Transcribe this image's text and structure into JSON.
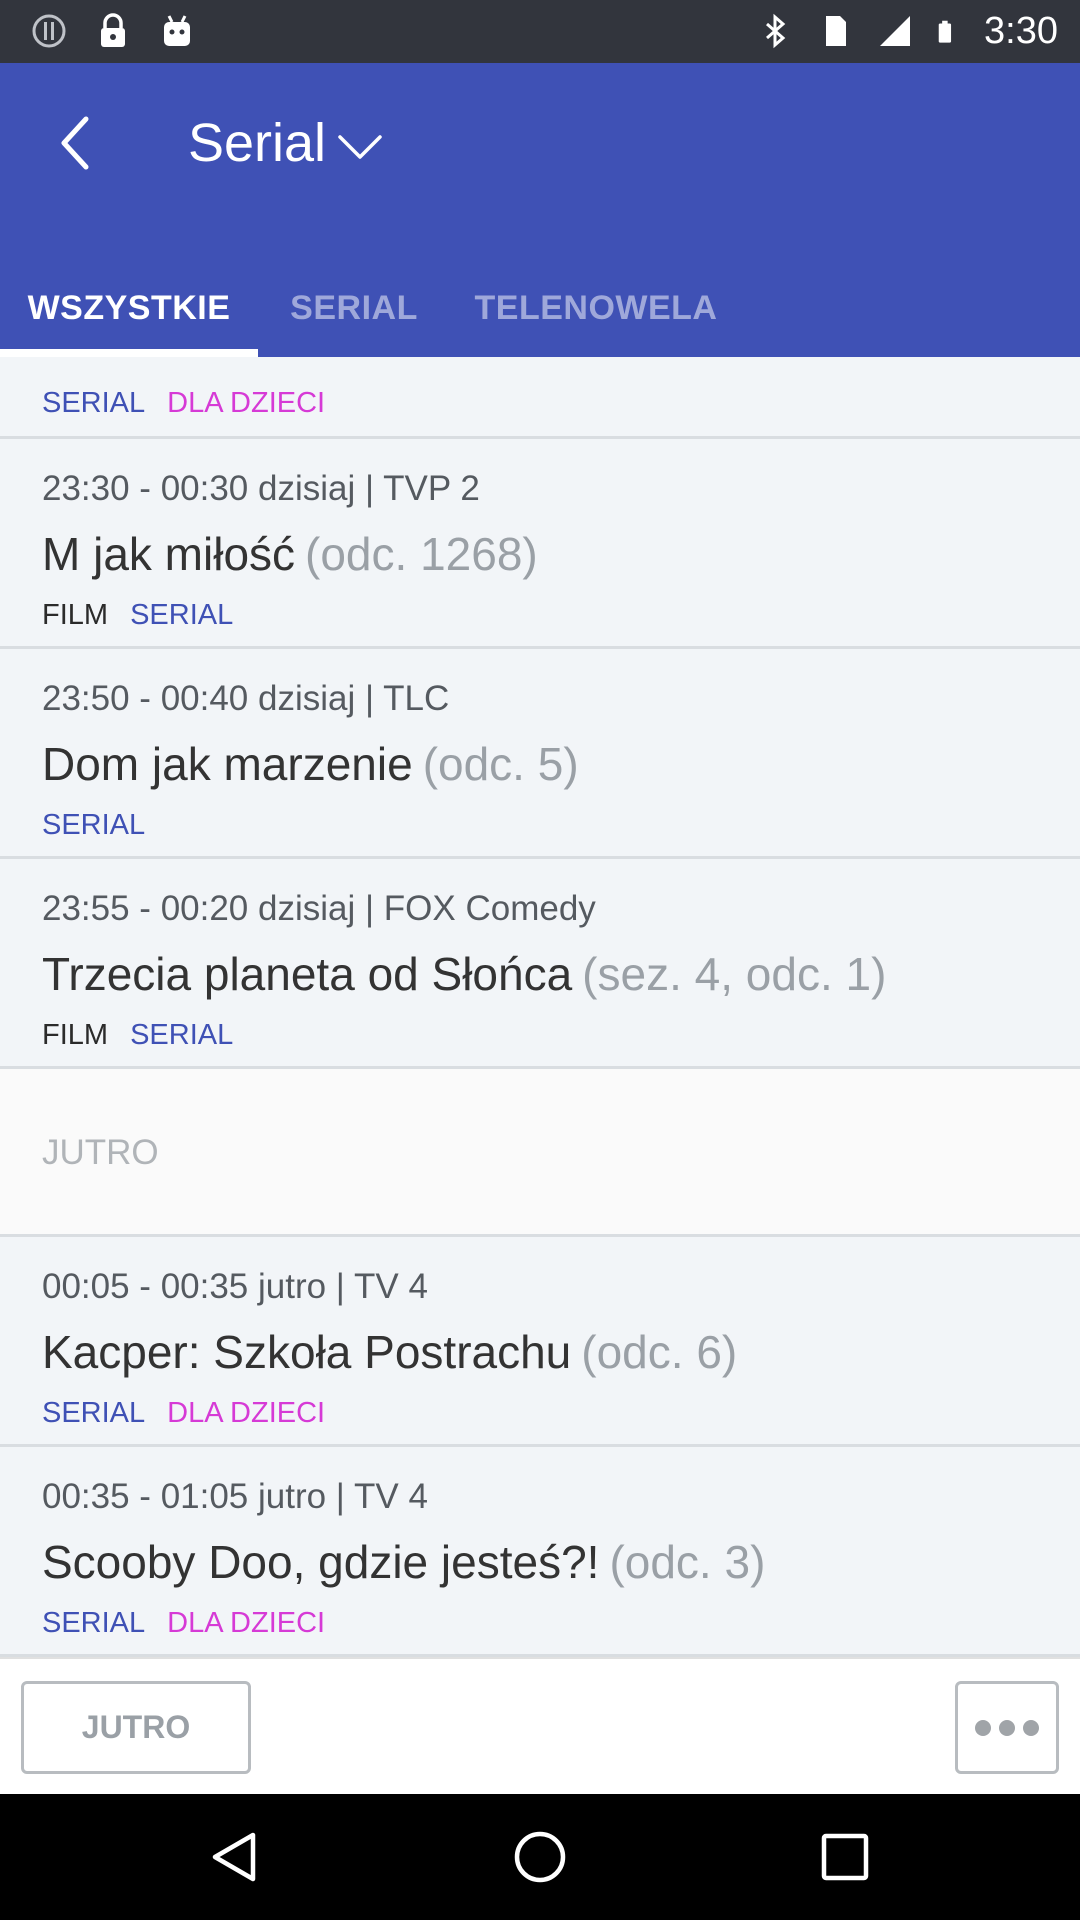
{
  "status_bar": {
    "time": "3:30",
    "icons": [
      "alert-icon",
      "lock-icon",
      "android-icon",
      "bluetooth-icon",
      "sim-icon",
      "signal-icon",
      "battery-icon"
    ]
  },
  "app_bar": {
    "title": "Serial",
    "tabs": [
      {
        "label": "WSZYSTKIE",
        "active": true
      },
      {
        "label": "SERIAL",
        "active": false
      },
      {
        "label": "TELENOWELA",
        "active": false
      }
    ],
    "colors": {
      "primary": "#3f51b5",
      "tab_inactive": "#9fa8da"
    }
  },
  "list": {
    "partial_item": {
      "tags": [
        "SERIAL",
        "DLA DZIECI"
      ]
    },
    "items_today": [
      {
        "time": "23:30 - 00:30 dzisiaj  |  TVP 2",
        "title": "M jak miłość",
        "episode": "(odc. 1268)",
        "tags": [
          "FILM",
          "SERIAL"
        ]
      },
      {
        "time": "23:50 - 00:40 dzisiaj  |  TLC",
        "title": "Dom jak marzenie",
        "episode": "(odc. 5)",
        "tags": [
          "SERIAL"
        ]
      },
      {
        "time": "23:55 - 00:20 dzisiaj  |  FOX Comedy",
        "title": "Trzecia planeta od Słońca",
        "episode": "(sez. 4, odc. 1)",
        "tags": [
          "FILM",
          "SERIAL"
        ]
      }
    ],
    "section_label": "JUTRO",
    "items_tomorrow": [
      {
        "time": "00:05 - 00:35 jutro  |  TV 4",
        "title": "Kacper: Szkoła Postrachu",
        "episode": "(odc. 6)",
        "tags": [
          "SERIAL",
          "DLA DZIECI"
        ]
      },
      {
        "time": "00:35 - 01:05 jutro  |  TV 4",
        "title": "Scooby Doo, gdzie jesteś?!",
        "episode": "(odc. 3)",
        "tags": [
          "SERIAL",
          "DLA DZIECI"
        ]
      }
    ],
    "tag_colors": {
      "SERIAL": "#3f51b5",
      "DLA DZIECI": "#d63ad6",
      "FILM": "#2b2b2b"
    }
  },
  "bottom_bar": {
    "jutro_button": "JUTRO",
    "more_icon": "more-horizontal-icon"
  },
  "nav_bar": {
    "icons": [
      "back-triangle-icon",
      "home-circle-icon",
      "recents-square-icon"
    ]
  }
}
